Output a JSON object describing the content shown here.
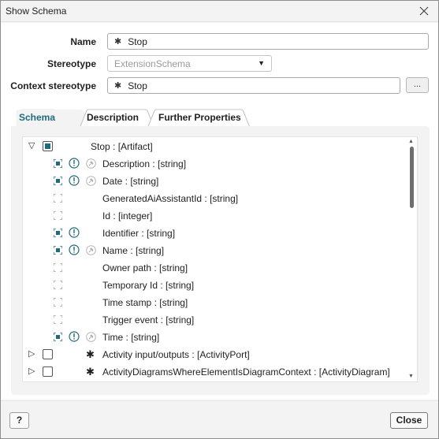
{
  "window": {
    "title": "Show Schema"
  },
  "form": {
    "name_label": "Name",
    "name_value": "Stop",
    "stereotype_label": "Stereotype",
    "stereotype_value": "ExtensionSchema",
    "context_label": "Context stereotype",
    "context_value": "Stop",
    "browse_label": "..."
  },
  "tabs": [
    {
      "label": "Schema",
      "active": true
    },
    {
      "label": "Description",
      "active": false
    },
    {
      "label": "Further Properties",
      "active": false
    }
  ],
  "tree": {
    "rows": [
      {
        "label": "Stop : [Artifact]",
        "kind": "root",
        "expander": "expanded",
        "checkbox": "indeterminate"
      },
      {
        "label": "Description : [string]",
        "selected": true,
        "required": true,
        "pin": true
      },
      {
        "label": "Date : [string]",
        "selected": true,
        "required": true,
        "pin": true
      },
      {
        "label": "GeneratedAiAssistantId : [string]",
        "selected": false,
        "required": false,
        "pin": false
      },
      {
        "label": "Id : [integer]",
        "selected": false,
        "required": false,
        "pin": false
      },
      {
        "label": "Identifier : [string]",
        "selected": true,
        "required": true,
        "pin": false
      },
      {
        "label": "Name : [string]",
        "selected": true,
        "required": true,
        "pin": true
      },
      {
        "label": "Owner path : [string]",
        "selected": false,
        "required": false,
        "pin": false
      },
      {
        "label": "Temporary Id : [string]",
        "selected": false,
        "required": false,
        "pin": false
      },
      {
        "label": "Time stamp : [string]",
        "selected": false,
        "required": false,
        "pin": false
      },
      {
        "label": "Trigger event : [string]",
        "selected": false,
        "required": false,
        "pin": false
      },
      {
        "label": "Time : [string]",
        "selected": true,
        "required": true,
        "pin": true
      },
      {
        "label": "Activity input/outputs : [ActivityPort]",
        "kind": "relation",
        "expander": "collapsed",
        "checkbox": "unchecked"
      },
      {
        "label": "ActivityDiagramsWhereElementIsDiagramContext : [ActivityDiagram]",
        "kind": "relation",
        "expander": "collapsed",
        "checkbox": "unchecked"
      }
    ]
  },
  "footer": {
    "help_label": "?",
    "close_label": "Close"
  },
  "colors": {
    "accent": "#1f6a7c",
    "selected_icon": "#1f6a7c",
    "border": "#a9a9a9"
  }
}
